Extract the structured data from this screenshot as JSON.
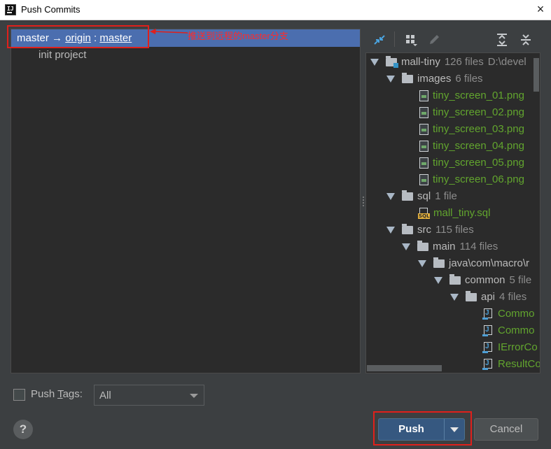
{
  "window": {
    "title": "Push Commits",
    "close_icon": "×"
  },
  "left": {
    "branch": {
      "local": "master",
      "arrow": "→",
      "remote": "origin",
      "separator": ":",
      "target": "master"
    },
    "commits": [
      "init project"
    ]
  },
  "annotation": {
    "text": "推送到远程的master分支",
    "color": "#e0201b"
  },
  "toolbar": {
    "icons": [
      "collapse-icon",
      "group-by-icon",
      "edit-icon",
      "expand-all-icon",
      "collapse-all-icon"
    ]
  },
  "tree": {
    "root": {
      "name": "mall-tiny",
      "count": "126 files",
      "path": "D:\\devel"
    },
    "images": {
      "name": "images",
      "count": "6 files"
    },
    "image_files": [
      "tiny_screen_01.png",
      "tiny_screen_02.png",
      "tiny_screen_03.png",
      "tiny_screen_04.png",
      "tiny_screen_05.png",
      "tiny_screen_06.png"
    ],
    "sql": {
      "name": "sql",
      "count": "1 file"
    },
    "sql_file": "mall_tiny.sql",
    "src": {
      "name": "src",
      "count": "115 files"
    },
    "main": {
      "name": "main",
      "count": "114 files"
    },
    "java": {
      "name": "java\\com\\macro\\r"
    },
    "common": {
      "name": "common",
      "count": "5 file"
    },
    "api": {
      "name": "api",
      "count": "4 files"
    },
    "java_files": [
      "Commo",
      "Commo",
      "IErrorCo",
      "ResultCo"
    ]
  },
  "bottom": {
    "push_tags_label_pre": "Push ",
    "push_tags_label_mnemonic": "T",
    "push_tags_label_post": "ags:",
    "tags_select": "All",
    "help": "?",
    "push_button": "Push",
    "cancel_button": "Cancel"
  },
  "colors": {
    "selection": "#4b6eaf",
    "added_file": "#62a52e",
    "push_button": "#365880"
  }
}
